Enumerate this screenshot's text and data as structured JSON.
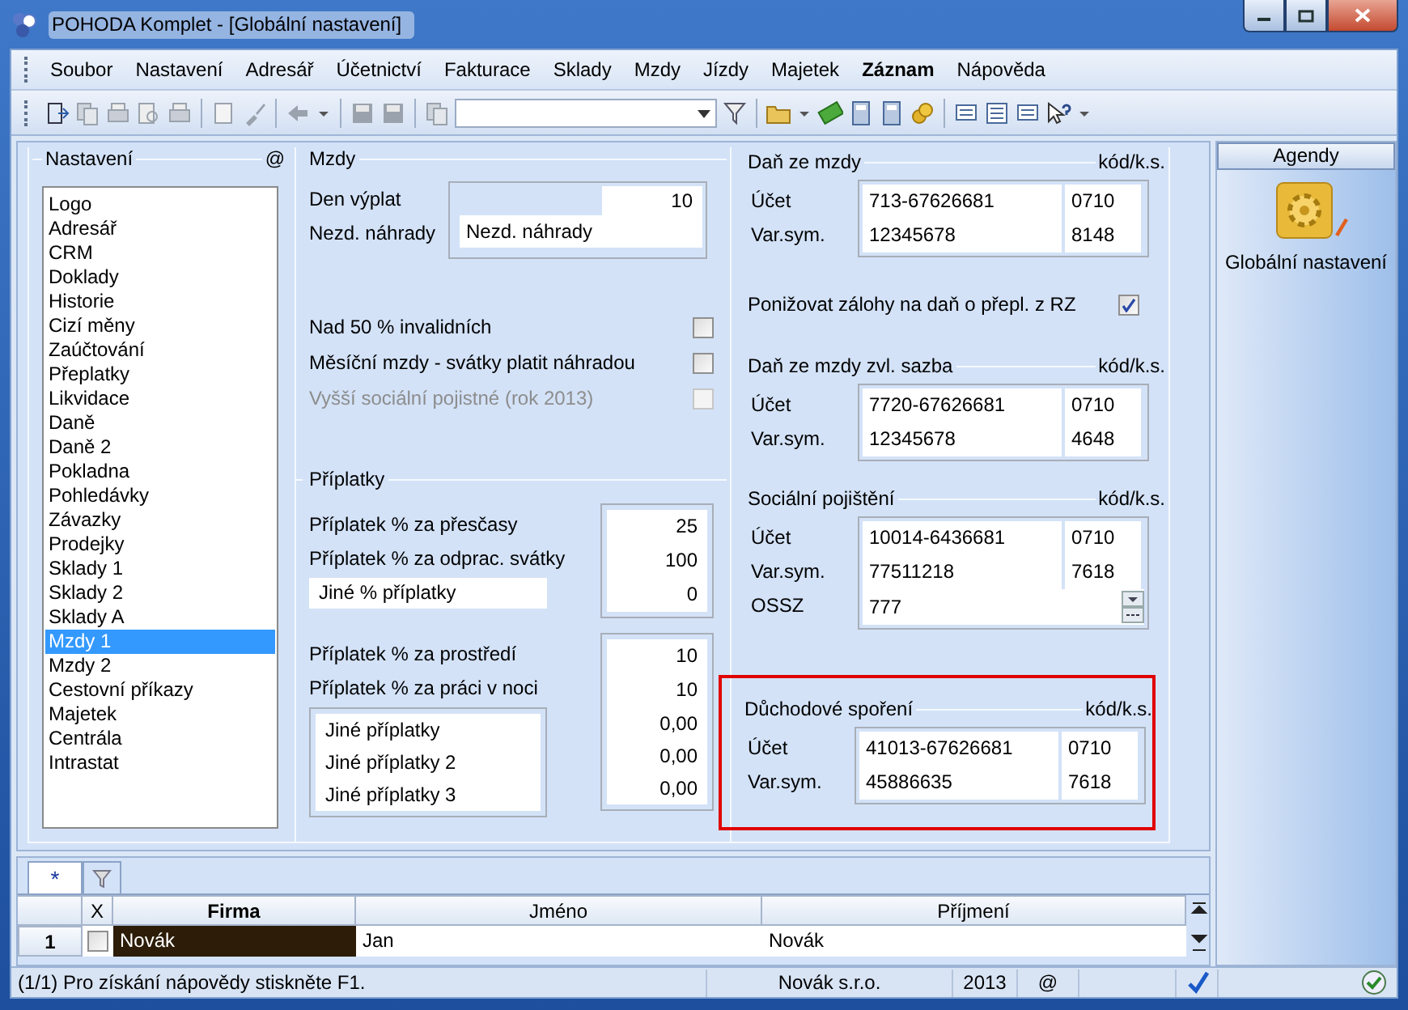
{
  "window": {
    "title": "POHODA Komplet - [Globální nastavení]"
  },
  "menu": [
    {
      "label": "Soubor",
      "bold": false
    },
    {
      "label": "Nastavení",
      "bold": false
    },
    {
      "label": "Adresář",
      "bold": false
    },
    {
      "label": "Účetnictví",
      "bold": false
    },
    {
      "label": "Fakturace",
      "bold": false
    },
    {
      "label": "Sklady",
      "bold": false
    },
    {
      "label": "Mzdy",
      "bold": false
    },
    {
      "label": "Jízdy",
      "bold": false
    },
    {
      "label": "Majetek",
      "bold": false
    },
    {
      "label": "Záznam",
      "bold": true
    },
    {
      "label": "Nápověda",
      "bold": false
    }
  ],
  "settings": {
    "title": "Nastavení",
    "at_sign": "@",
    "items": [
      {
        "label": "Logo",
        "selected": false
      },
      {
        "label": "Adresář",
        "selected": false
      },
      {
        "label": "CRM",
        "selected": false
      },
      {
        "label": "Doklady",
        "selected": false
      },
      {
        "label": "Historie",
        "selected": false
      },
      {
        "label": "Cizí měny",
        "selected": false
      },
      {
        "label": "Zaúčtování",
        "selected": false
      },
      {
        "label": "Přeplatky",
        "selected": false
      },
      {
        "label": "Likvidace",
        "selected": false
      },
      {
        "label": "Daně",
        "selected": false
      },
      {
        "label": "Daně 2",
        "selected": false
      },
      {
        "label": "Pokladna",
        "selected": false
      },
      {
        "label": "Pohledávky",
        "selected": false
      },
      {
        "label": "Závazky",
        "selected": false
      },
      {
        "label": "Prodejky",
        "selected": false
      },
      {
        "label": "Sklady 1",
        "selected": false
      },
      {
        "label": "Sklady 2",
        "selected": false
      },
      {
        "label": "Sklady A",
        "selected": false
      },
      {
        "label": "Mzdy 1",
        "selected": true
      },
      {
        "label": "Mzdy 2",
        "selected": false
      },
      {
        "label": "Cestovní příkazy",
        "selected": false
      },
      {
        "label": "Majetek",
        "selected": false
      },
      {
        "label": "Centrála",
        "selected": false
      },
      {
        "label": "Intrastat",
        "selected": false
      }
    ]
  },
  "mzdy": {
    "title": "Mzdy",
    "pay_day": {
      "label": "Den výplat",
      "value": "10"
    },
    "compensation": {
      "label": "Nezd. náhrady",
      "value": "Nezd. náhrady"
    },
    "checks": [
      {
        "label": "Nad 50 % invalidních",
        "checked": false,
        "disabled": false
      },
      {
        "label": "Měsíční mzdy - svátky platit náhradou",
        "checked": false,
        "disabled": false
      },
      {
        "label": "Vyšší sociální pojistné (rok 2013)",
        "checked": false,
        "disabled": true
      }
    ],
    "surcharges": {
      "title": "Příplatky",
      "groups": [
        {
          "rows": [
            {
              "kind": "fixed",
              "label": "Příplatek % za přesčasy",
              "value": "25"
            },
            {
              "kind": "fixed",
              "label": "Příplatek % za odprac. svátky",
              "value": "100"
            },
            {
              "kind": "custom",
              "label": "Jiné % příplatky",
              "value": "0"
            }
          ]
        },
        {
          "rows": [
            {
              "kind": "fixed",
              "label": "Příplatek % za prostředí",
              "value": "10"
            },
            {
              "kind": "fixed",
              "label": "Příplatek % za práci v noci",
              "value": "10"
            },
            {
              "kind": "custom",
              "label": "Jiné příplatky",
              "value": "0,00"
            },
            {
              "kind": "custom",
              "label": "Jiné příplatky 2",
              "value": "0,00"
            },
            {
              "kind": "custom",
              "label": "Jiné příplatky 3",
              "value": "0,00"
            }
          ]
        }
      ]
    }
  },
  "sections": [
    {
      "kind": "account",
      "title": "Daň ze mzdy",
      "code_header": "kód/k.s.",
      "highlighted": false,
      "rows": [
        {
          "label": "Účet",
          "value": "713-67626681",
          "code": "0710"
        },
        {
          "label": "Var.sym.",
          "value": "12345678",
          "code": "8148"
        }
      ]
    },
    {
      "kind": "check",
      "label": "Ponižovat zálohy na daň o přepl. z RZ",
      "checked": true
    },
    {
      "kind": "account",
      "title": "Daň ze mzdy zvl. sazba",
      "code_header": "kód/k.s.",
      "highlighted": false,
      "rows": [
        {
          "label": "Účet",
          "value": "7720-67626681",
          "code": "0710"
        },
        {
          "label": "Var.sym.",
          "value": "12345678",
          "code": "4648"
        }
      ]
    },
    {
      "kind": "account",
      "title": "Sociální pojištění",
      "code_header": "kód/k.s.",
      "highlighted": false,
      "rows": [
        {
          "label": "Účet",
          "value": "10014-6436681",
          "code": "0710"
        },
        {
          "label": "Var.sym.",
          "value": "77511218",
          "code": "7618"
        }
      ],
      "office": {
        "label": "OSSZ",
        "value": "777"
      }
    },
    {
      "kind": "account",
      "title": "Důchodové spoření",
      "code_header": "kód/k.s.",
      "highlighted": true,
      "rows": [
        {
          "label": "Účet",
          "value": "41013-67626681",
          "code": "0710"
        },
        {
          "label": "Var.sym.",
          "value": "45886635",
          "code": "7618"
        }
      ]
    }
  ],
  "agendas": {
    "title": "Agendy",
    "item": "Globální nastavení"
  },
  "grid": {
    "tabs": [
      {
        "kind": "new",
        "label": "*",
        "selected": true
      },
      {
        "kind": "filter",
        "selected": false
      }
    ],
    "columns": [
      {
        "label": "X",
        "sorted": false
      },
      {
        "label": "Firma",
        "sorted": true
      },
      {
        "label": "Jméno",
        "sorted": false
      },
      {
        "label": "Příjmení",
        "sorted": false
      }
    ],
    "rows": [
      {
        "number": "1",
        "checked": false,
        "cells": [
          "Novák",
          "Jan",
          "Novák"
        ]
      }
    ]
  },
  "status_bar": {
    "message": "(1/1) Pro získání nápovědy stiskněte F1.",
    "company": "Novák  s.r.o.",
    "year": "2013",
    "at_sign": "@"
  }
}
